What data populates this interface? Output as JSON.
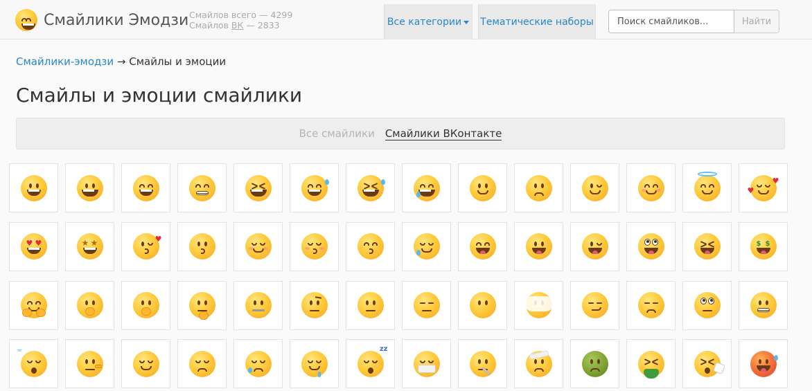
{
  "header": {
    "site_title": "Смайлики Эмодзи",
    "stats_total_label": "Смайлов всего — 4299",
    "stats_vk_prefix": "Смайлов ",
    "stats_vk_abbr": "ВК",
    "stats_vk_suffix": " — 2833",
    "nav_all_categories": "Все категории",
    "nav_theme_sets": "Тематические наборы",
    "search_placeholder": "Поиск смайликов...",
    "search_button": "Найти"
  },
  "breadcrumb": {
    "root_link": "Смайлики-эмодзи",
    "separator": " → ",
    "current": "Смайлы и эмоции"
  },
  "page_title": "Смайлы и эмоции смайлики",
  "filter": {
    "all_label": "Все смайлики",
    "vk_label": "Смайлики ВКонтакте"
  },
  "emoji_grid": {
    "items": [
      {
        "name": "grinning-face-icon",
        "eyes": "oval",
        "mouth": "grin"
      },
      {
        "name": "grinning-face-big-eyes-icon",
        "eyes": "oval",
        "mouth": "wide"
      },
      {
        "name": "grinning-face-smiling-eyes-icon",
        "eyes": "arc",
        "mouth": "grin"
      },
      {
        "name": "beaming-face-icon",
        "eyes": "arc",
        "mouth": "teeth"
      },
      {
        "name": "grinning-squinting-face-icon",
        "eyes": "x",
        "mouth": "wide"
      },
      {
        "name": "grinning-face-sweat-icon",
        "eyes": "arc",
        "mouth": "grin",
        "acc": "tear"
      },
      {
        "name": "rolling-on-floor-laughing-icon",
        "eyes": "x",
        "mouth": "wide",
        "acc": "tear"
      },
      {
        "name": "face-tears-of-joy-icon",
        "eyes": "arc",
        "mouth": "wide",
        "acc": "tearlow"
      },
      {
        "name": "slightly-smiling-face-icon",
        "eyes": "oval",
        "mouth": "smile"
      },
      {
        "name": "upside-down-face-icon",
        "eyes": "oval",
        "mouth": "sad"
      },
      {
        "name": "winking-face-icon",
        "eyes": "wink",
        "mouth": "smile"
      },
      {
        "name": "smiling-face-smiling-eyes-icon",
        "eyes": "arc",
        "mouth": "smile",
        "acc": "blush"
      },
      {
        "name": "smiling-face-halo-icon",
        "eyes": "arc",
        "mouth": "smile",
        "acc": "halo"
      },
      {
        "name": "smiling-face-hearts-icon",
        "eyes": "closed",
        "mouth": "smile",
        "acc": "hearts"
      },
      {
        "name": "heart-eyes-icon",
        "eyes": "heart",
        "mouth": "grin"
      },
      {
        "name": "star-struck-icon",
        "eyes": "star",
        "mouth": "grin"
      },
      {
        "name": "face-blowing-kiss-icon",
        "eyes": "wink",
        "mouth": "kiss",
        "acc": "hearts2"
      },
      {
        "name": "kissing-face-icon",
        "eyes": "oval",
        "mouth": "kiss"
      },
      {
        "name": "smiling-face-icon",
        "eyes": "closed",
        "mouth": "smile",
        "acc": "blush"
      },
      {
        "name": "kissing-face-closed-eyes-icon",
        "eyes": "closed",
        "mouth": "kiss",
        "acc": "blush"
      },
      {
        "name": "kissing-face-smiling-eyes-icon",
        "eyes": "arc",
        "mouth": "kiss"
      },
      {
        "name": "smiling-face-tear-icon",
        "eyes": "closed",
        "mouth": "smile",
        "acc": "tearlow"
      },
      {
        "name": "face-savoring-food-icon",
        "eyes": "arc",
        "mouth": "tongue"
      },
      {
        "name": "face-with-tongue-icon",
        "eyes": "oval",
        "mouth": "tongue"
      },
      {
        "name": "winking-face-tongue-icon",
        "eyes": "wink",
        "mouth": "tongue"
      },
      {
        "name": "zany-face-icon",
        "eyes": "big",
        "mouth": "tongue"
      },
      {
        "name": "squinting-face-tongue-icon",
        "eyes": "x",
        "mouth": "tongue"
      },
      {
        "name": "money-mouth-face-icon",
        "eyes": "cash",
        "mouth": "tongue"
      },
      {
        "name": "hugging-face-icon",
        "eyes": "arc",
        "mouth": "smile",
        "acc": "hands"
      },
      {
        "name": "face-hand-over-mouth-icon",
        "eyes": "oval",
        "mouth": "none",
        "acc": "hand"
      },
      {
        "name": "shushing-face-icon",
        "eyes": "oval",
        "mouth": "none",
        "acc": "hand"
      },
      {
        "name": "thinking-face-icon",
        "eyes": "oval",
        "mouth": "flat",
        "acc": "chin"
      },
      {
        "name": "zipper-mouth-face-icon",
        "eyes": "oval",
        "mouth": "zip"
      },
      {
        "name": "face-raised-eyebrow-icon",
        "eyes": "oval",
        "mouth": "flat",
        "acc": "brow"
      },
      {
        "name": "neutral-face-icon",
        "eyes": "oval",
        "mouth": "flat"
      },
      {
        "name": "expressionless-face-icon",
        "eyes": "line",
        "mouth": "flat"
      },
      {
        "name": "face-without-mouth-icon",
        "eyes": "oval",
        "mouth": "none"
      },
      {
        "name": "face-in-clouds-icon",
        "eyes": "oval",
        "mouth": "none",
        "acc": "cloud"
      },
      {
        "name": "smirking-face-icon",
        "eyes": "line",
        "mouth": "smirk"
      },
      {
        "name": "unamused-face-icon",
        "eyes": "line",
        "mouth": "sad"
      },
      {
        "name": "face-rolling-eyes-icon",
        "eyes": "big",
        "mouth": "flat"
      },
      {
        "name": "grimacing-face-icon",
        "eyes": "oval",
        "mouth": "teeth"
      },
      {
        "name": "face-exhaling-icon",
        "eyes": "closed",
        "mouth": "o",
        "acc": "steam"
      },
      {
        "name": "lying-face-icon",
        "eyes": "oval",
        "mouth": "flat",
        "acc": "nose"
      },
      {
        "name": "relieved-face-icon",
        "eyes": "closed",
        "mouth": "smile"
      },
      {
        "name": "pensive-face-icon",
        "eyes": "closed",
        "mouth": "sad"
      },
      {
        "name": "sleepy-face-icon",
        "eyes": "closed",
        "mouth": "sad",
        "acc": "tearlow"
      },
      {
        "name": "drooling-face-icon",
        "eyes": "closed",
        "mouth": "smile",
        "acc": "drool"
      },
      {
        "name": "sleeping-face-icon",
        "eyes": "closed",
        "mouth": "o",
        "acc": "zz"
      },
      {
        "name": "face-medical-mask-icon",
        "eyes": "closed",
        "mouth": "mask"
      },
      {
        "name": "face-with-thermometer-icon",
        "eyes": "oval",
        "mouth": "flat",
        "acc": "thermo"
      },
      {
        "name": "face-head-bandage-icon",
        "eyes": "oval",
        "mouth": "sad",
        "acc": "bandage"
      },
      {
        "name": "nauseated-face-icon",
        "eyes": "oval",
        "mouth": "sad",
        "tone": "green"
      },
      {
        "name": "face-vomiting-icon",
        "eyes": "x",
        "mouth": "none",
        "acc": "vomit"
      },
      {
        "name": "sneezing-face-icon",
        "eyes": "x",
        "mouth": "o",
        "acc": "tissue"
      },
      {
        "name": "hot-face-icon",
        "eyes": "oval",
        "mouth": "tongue",
        "tone": "red",
        "acc": "tear"
      }
    ]
  }
}
